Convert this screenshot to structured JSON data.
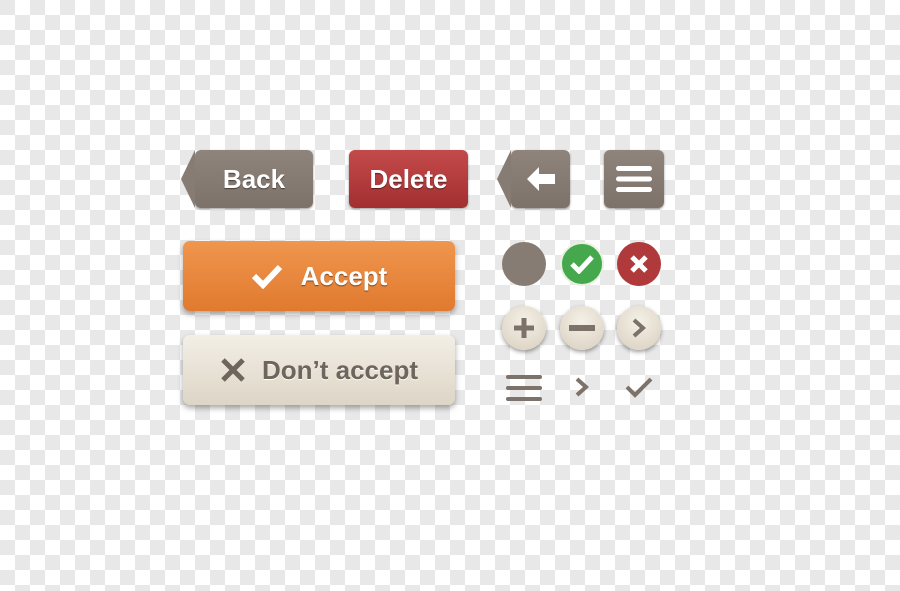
{
  "buttons": {
    "back": "Back",
    "delete": "Delete",
    "accept": "Accept",
    "dont_accept": "Don’t accept"
  },
  "colors": {
    "brown": "#877c73",
    "red": "#b03a3b",
    "orange": "#e8873c",
    "cream": "#e9e3d7",
    "green": "#45a84d"
  },
  "icons": [
    "arrow-left-icon",
    "menu-icon",
    "circle-icon",
    "check-icon",
    "close-icon",
    "plus-icon",
    "minus-icon",
    "chevron-right-icon"
  ]
}
